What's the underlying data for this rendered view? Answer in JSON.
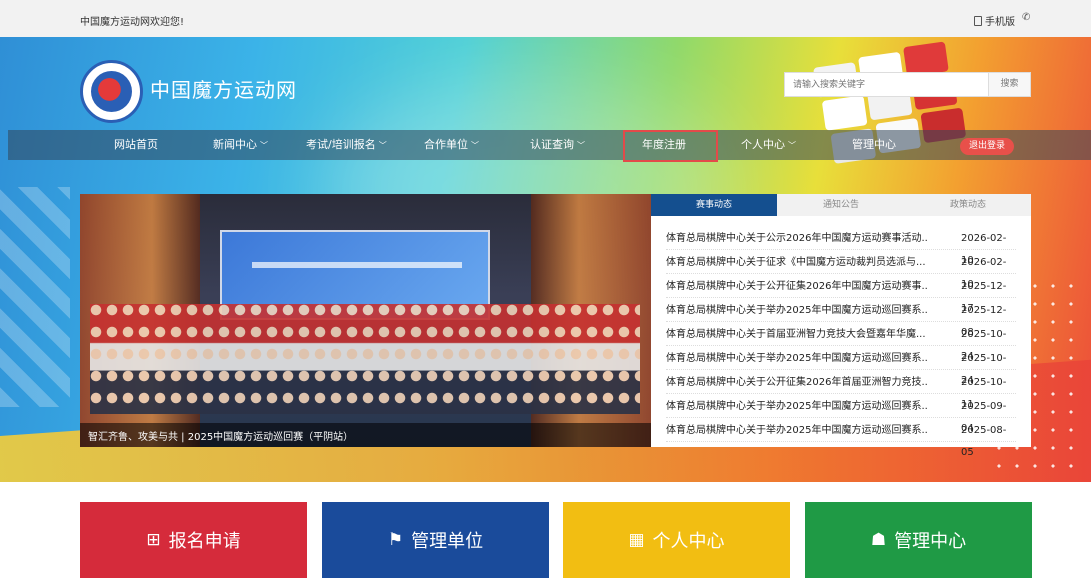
{
  "topbar": {
    "welcome": "中国魔方运动网欢迎您!",
    "mobile": "手机版",
    "wechat_glyph": "✆"
  },
  "site": {
    "name": "中国魔方运动网"
  },
  "search": {
    "placeholder": "请输入搜索关键字",
    "button": "搜索"
  },
  "nav": {
    "items": [
      {
        "label": "网站首页",
        "chevron": ""
      },
      {
        "label": "新闻中心",
        "chevron": "﹀"
      },
      {
        "label": "考试/培训报名",
        "chevron": "﹀"
      },
      {
        "label": "合作单位",
        "chevron": "﹀"
      },
      {
        "label": "认证查询",
        "chevron": "﹀"
      },
      {
        "label": "年度注册",
        "chevron": ""
      },
      {
        "label": "个人中心",
        "chevron": "﹀"
      },
      {
        "label": "管理中心",
        "chevron": ""
      }
    ],
    "logout": "退出登录"
  },
  "slider": {
    "caption": "智汇齐鲁、攻美与共 | 2025中国魔方运动巡回赛（平阴站）"
  },
  "news": {
    "tabs": [
      "赛事动态",
      "通知公告",
      "政策动态"
    ],
    "rows": [
      {
        "title": "体育总局棋牌中心关于公示2026年中国魔方运动赛事活动...",
        "date": "2026-02-10"
      },
      {
        "title": "体育总局棋牌中心关于征求《中国魔方运动裁判员选派与...",
        "date": "2026-02-10"
      },
      {
        "title": "体育总局棋牌中心关于公开征集2026年中国魔方运动赛事...",
        "date": "2025-12-17"
      },
      {
        "title": "体育总局棋牌中心关于举办2025年中国魔方运动巡回赛系...",
        "date": "2025-12-08"
      },
      {
        "title": "体育总局棋牌中心关于首届亚洲智力竞技大会暨嘉年华魔...",
        "date": "2025-10-24"
      },
      {
        "title": "体育总局棋牌中心关于举办2025年中国魔方运动巡回赛系...",
        "date": "2025-10-24"
      },
      {
        "title": "体育总局棋牌中心关于公开征集2026年首届亚洲智力竞技...",
        "date": "2025-10-11"
      },
      {
        "title": "体育总局棋牌中心关于举办2025年中国魔方运动巡回赛系...",
        "date": "2025-09-04"
      },
      {
        "title": "体育总局棋牌中心关于举办2025年中国魔方运动巡回赛系...",
        "date": "2025-08-05"
      }
    ]
  },
  "tiles": [
    {
      "label": "报名申请",
      "icon": "⊞",
      "color": "#d52b3b"
    },
    {
      "label": "管理单位",
      "icon": "⚑",
      "color": "#1a4b9b"
    },
    {
      "label": "个人中心",
      "icon": "▦",
      "color": "#f2be12"
    },
    {
      "label": "管理中心",
      "icon": "☗",
      "color": "#1f9a45"
    }
  ],
  "colors": {
    "news_tab_active": "#144f8f",
    "logout": "#e8504a",
    "highlight": "#e34a4a"
  }
}
